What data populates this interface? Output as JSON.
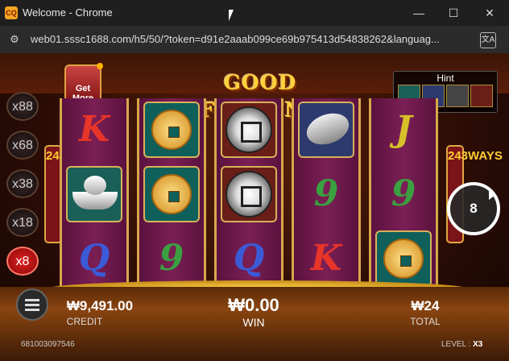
{
  "window": {
    "title": "Welcome - Chrome",
    "app_icon": "CQ"
  },
  "controls": {
    "minimize": "—",
    "maximize": "☐",
    "close": "✕"
  },
  "address": {
    "url": "web01.sssc1688.com/h5/50/?token=d91e2aaab099ce69b975413d54838262&languag..."
  },
  "game": {
    "logo": "GOOD FORTUNE",
    "get_more": "Get More",
    "hint_label": "Hint",
    "ways_text": "243WAYS",
    "multipliers": [
      "x88",
      "x68",
      "x38",
      "x18",
      "x8"
    ],
    "active_multiplier": "x8",
    "spin_count": "8",
    "credit_value": "₩9,491.00",
    "credit_label": "CREDIT",
    "win_value": "₩0.00",
    "win_label": "WIN",
    "total_value": "₩24",
    "total_label": "TOTAL",
    "game_id": "681003097546",
    "level_label": "LEVEL :",
    "level_value": "X3",
    "reels": [
      [
        "K",
        "ingot",
        "Q"
      ],
      [
        "coin",
        "coin",
        "9"
      ],
      [
        "medal",
        "medal",
        "Q"
      ],
      [
        "fish",
        "9",
        "K"
      ],
      [
        "J",
        "9",
        "coin"
      ]
    ]
  }
}
